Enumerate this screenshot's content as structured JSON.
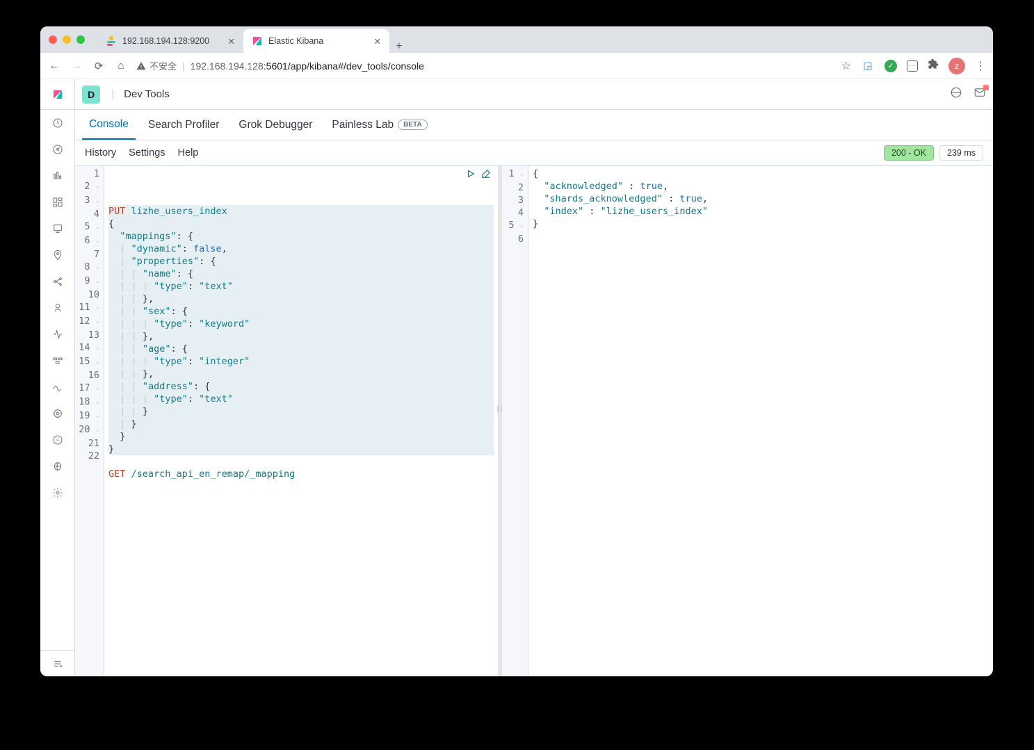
{
  "browser": {
    "tab1_title": "192.168.194.128:9200",
    "tab2_title": "Elastic Kibana",
    "warn_label": "不安全",
    "url_host": "192.168.194.128",
    "url_path": ":5601/app/kibana#/dev_tools/console",
    "avatar_letter": "z"
  },
  "header": {
    "space_letter": "D",
    "breadcrumb": "Dev Tools"
  },
  "tabs": {
    "console": "Console",
    "search_profiler": "Search Profiler",
    "grok": "Grok Debugger",
    "painless": "Painless Lab",
    "beta": "BETA"
  },
  "toolbar": {
    "history": "History",
    "settings": "Settings",
    "help": "Help",
    "status": "200 - OK",
    "timing": "239 ms"
  },
  "editor": {
    "request_lines": [
      {
        "n": 1,
        "fold": "",
        "sel": true,
        "html": "<span class='hl'>PUT</span> <span class='ident'>lizhe_users_index</span>"
      },
      {
        "n": 2,
        "fold": "-",
        "sel": true,
        "html": "{"
      },
      {
        "n": 3,
        "fold": "-",
        "sel": true,
        "html": "  <span class='str'>\"mappings\"</span>: {"
      },
      {
        "n": 4,
        "fold": "",
        "sel": true,
        "html": "  <span class='guide'>|</span> <span class='str'>\"dynamic\"</span>: <span class='bool'>false</span>,"
      },
      {
        "n": 5,
        "fold": "-",
        "sel": true,
        "html": "  <span class='guide'>|</span> <span class='str'>\"properties\"</span>: {"
      },
      {
        "n": 6,
        "fold": "-",
        "sel": true,
        "html": "  <span class='guide'>|</span> <span class='guide'>|</span> <span class='str'>\"name\"</span>: {"
      },
      {
        "n": 7,
        "fold": "",
        "sel": true,
        "html": "  <span class='guide'>|</span> <span class='guide'>|</span> <span class='guide'>|</span> <span class='str'>\"type\"</span>: <span class='str'>\"text\"</span>"
      },
      {
        "n": 8,
        "fold": "-",
        "sel": true,
        "html": "  <span class='guide'>|</span> <span class='guide'>|</span> },"
      },
      {
        "n": 9,
        "fold": "-",
        "sel": true,
        "html": "  <span class='guide'>|</span> <span class='guide'>|</span> <span class='str'>\"sex\"</span>: {"
      },
      {
        "n": 10,
        "fold": "",
        "sel": true,
        "html": "  <span class='guide'>|</span> <span class='guide'>|</span> <span class='guide'>|</span> <span class='str'>\"type\"</span>: <span class='str'>\"keyword\"</span>"
      },
      {
        "n": 11,
        "fold": "-",
        "sel": true,
        "html": "  <span class='guide'>|</span> <span class='guide'>|</span> },"
      },
      {
        "n": 12,
        "fold": "-",
        "sel": true,
        "html": "  <span class='guide'>|</span> <span class='guide'>|</span> <span class='str'>\"age\"</span>: {"
      },
      {
        "n": 13,
        "fold": "",
        "sel": true,
        "html": "  <span class='guide'>|</span> <span class='guide'>|</span> <span class='guide'>|</span> <span class='str'>\"type\"</span>: <span class='str'>\"integer\"</span>"
      },
      {
        "n": 14,
        "fold": "-",
        "sel": true,
        "html": "  <span class='guide'>|</span> <span class='guide'>|</span> },"
      },
      {
        "n": 15,
        "fold": "-",
        "sel": true,
        "html": "  <span class='guide'>|</span> <span class='guide'>|</span> <span class='str'>\"address\"</span>: {"
      },
      {
        "n": 16,
        "fold": "",
        "sel": true,
        "html": "  <span class='guide'>|</span> <span class='guide'>|</span> <span class='guide'>|</span> <span class='str'>\"type\"</span>: <span class='str'>\"text\"</span>"
      },
      {
        "n": 17,
        "fold": "-",
        "sel": true,
        "html": "  <span class='guide'>|</span> <span class='guide'>|</span> }"
      },
      {
        "n": 18,
        "fold": "-",
        "sel": true,
        "html": "  <span class='guide'>|</span> }"
      },
      {
        "n": 19,
        "fold": "-",
        "sel": true,
        "html": "  }"
      },
      {
        "n": 20,
        "fold": "-",
        "sel": true,
        "html": "}"
      },
      {
        "n": 21,
        "fold": "",
        "sel": false,
        "html": " "
      },
      {
        "n": 22,
        "fold": "",
        "sel": false,
        "html": "<span class='hl'>GET</span> <span class='ident'>/search_api_en_remap/_mapping</span>"
      }
    ],
    "response_lines": [
      {
        "n": 1,
        "fold": "-",
        "html": "{"
      },
      {
        "n": 2,
        "fold": "",
        "html": "  <span class='str'>\"acknowledged\"</span> : <span class='bool'>true</span>,"
      },
      {
        "n": 3,
        "fold": "",
        "html": "  <span class='str'>\"shards_acknowledged\"</span> : <span class='bool'>true</span>,"
      },
      {
        "n": 4,
        "fold": "",
        "html": "  <span class='str'>\"index\"</span> : <span class='str'>\"lizhe_users_index\"</span>"
      },
      {
        "n": 5,
        "fold": "-",
        "html": "}"
      },
      {
        "n": 6,
        "fold": "",
        "html": " "
      }
    ]
  }
}
